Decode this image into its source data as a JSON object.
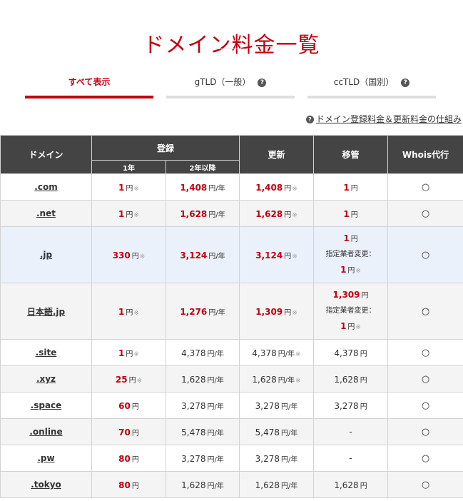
{
  "page": {
    "title": "ドメイン料金一覧"
  },
  "tabs": [
    {
      "label": "すべて表示",
      "active": true
    },
    {
      "label": "gTLD（一般）",
      "help": "?"
    },
    {
      "label": "ccTLD（国別）",
      "help": "?"
    }
  ],
  "price_link": {
    "help": "?",
    "label": "ドメイン登録料金＆更新料金の仕組み"
  },
  "table": {
    "headers": {
      "domain": "ドメイン",
      "registration": "登録",
      "first_year": "1年",
      "subsequent": "2年以降",
      "renewal": "更新",
      "transfer": "移管",
      "whois": "Whois代行"
    },
    "units": {
      "yen": "円",
      "per_year": "円/年",
      "note": "※"
    },
    "transfer_note_label": "指定業者変更：",
    "rows": [
      {
        "domain": ".com",
        "first": "1",
        "next": "1,408",
        "renew": "1,408",
        "transfer": "1",
        "whois": "○"
      },
      {
        "domain": ".net",
        "first": "1",
        "next": "1,628",
        "renew": "1,628",
        "transfer": "1",
        "whois": "○"
      },
      {
        "domain": ".jp",
        "first": "330",
        "next": "3,124",
        "renew": "3,124",
        "transfer": "1",
        "transfer_designated": "1",
        "whois": "○"
      },
      {
        "domain": "日本語.jp",
        "first": "1",
        "next": "1,276",
        "renew": "1,309",
        "transfer": "1,309",
        "transfer_designated": "1",
        "whois": "○"
      },
      {
        "domain": ".site",
        "first": "1",
        "next": "4,378",
        "renew": "4,378",
        "transfer": "4,378",
        "whois": "○"
      },
      {
        "domain": ".xyz",
        "first": "25",
        "next": "1,628",
        "renew": "1,628",
        "transfer": "1,628",
        "whois": "○"
      },
      {
        "domain": ".space",
        "first": "60",
        "next": "3,278",
        "renew": "3,278",
        "transfer": "3,278",
        "whois": "○"
      },
      {
        "domain": ".online",
        "first": "70",
        "next": "5,478",
        "renew": "5,478",
        "transfer": "-",
        "whois": "○"
      },
      {
        "domain": ".pw",
        "first": "80",
        "next": "3,278",
        "renew": "3,278",
        "transfer": "-",
        "whois": "○"
      },
      {
        "domain": ".tokyo",
        "first": "80",
        "next": "1,628",
        "renew": "1,628",
        "transfer": "1,628",
        "whois": "○"
      }
    ]
  },
  "colors": {
    "accent": "#c00011",
    "header_bg": "#444444",
    "row_alt": "#f4f4f4",
    "row_highlight": "#ebf1fb"
  }
}
